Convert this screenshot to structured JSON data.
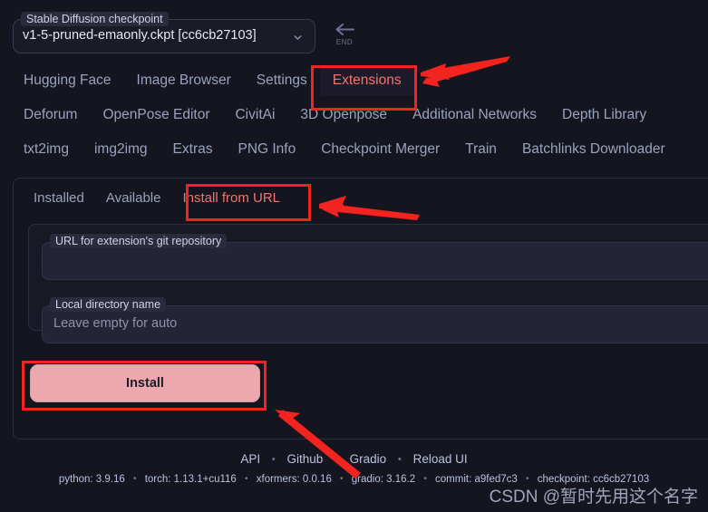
{
  "quick_settings": {
    "checkpoint": {
      "label": "Stable Diffusion checkpoint",
      "value": "v1-5-pruned-emaonly.ckpt [cc6cb27103]",
      "chevron_icon": "chevron-down-icon"
    },
    "end_key_hint": {
      "arrow_icon": "arrow-left-icon",
      "text": "END"
    }
  },
  "tabs": {
    "row1": [
      {
        "label": "Hugging Face",
        "selected": false
      },
      {
        "label": "Image Browser",
        "selected": false
      },
      {
        "label": "Settings",
        "selected": false
      },
      {
        "label": "Extensions",
        "selected": true
      }
    ],
    "row2": [
      {
        "label": "Deforum",
        "selected": false
      },
      {
        "label": "OpenPose Editor",
        "selected": false
      },
      {
        "label": "CivitAi",
        "selected": false
      },
      {
        "label": "3D Openpose",
        "selected": false
      },
      {
        "label": "Additional Networks",
        "selected": false
      },
      {
        "label": "Depth Library",
        "selected": false
      }
    ],
    "row3": [
      {
        "label": "txt2img",
        "selected": false
      },
      {
        "label": "img2img",
        "selected": false
      },
      {
        "label": "Extras",
        "selected": false
      },
      {
        "label": "PNG Info",
        "selected": false
      },
      {
        "label": "Checkpoint Merger",
        "selected": false
      },
      {
        "label": "Train",
        "selected": false
      },
      {
        "label": "Batchlinks Downloader",
        "selected": false
      }
    ]
  },
  "extensions": {
    "subtabs": [
      {
        "label": "Installed",
        "selected": false
      },
      {
        "label": "Available",
        "selected": false
      },
      {
        "label": "Install from URL",
        "selected": true
      }
    ],
    "fields": {
      "url": {
        "label": "URL for extension's git repository",
        "value": "",
        "placeholder": ""
      },
      "local_dir": {
        "label": "Local directory name",
        "value": "",
        "placeholder": "Leave empty for auto"
      }
    },
    "install_button": "Install"
  },
  "footer": {
    "links": [
      {
        "label": "API"
      },
      {
        "label": "Github"
      },
      {
        "label": "Gradio"
      },
      {
        "label": "Reload UI"
      }
    ],
    "separator": "•",
    "versions": [
      "python: 3.9.16",
      "torch: 1.13.1+cu116",
      "xformers: 0.0.16",
      "gradio: 3.16.2",
      "commit: a9fed7c3",
      "checkpoint: cc6cb27103"
    ]
  },
  "watermark": "CSDN @暂时先用这个名字",
  "annotations": {
    "color": "#f3241f",
    "boxes": [
      {
        "target": "extensions-tab"
      },
      {
        "target": "install-from-url-subtab"
      },
      {
        "target": "install-button"
      }
    ],
    "arrows": [
      {
        "target": "extensions-tab",
        "direction": "left"
      },
      {
        "target": "install-from-url-subtab",
        "direction": "left"
      },
      {
        "target": "install-button",
        "direction": "up-left"
      }
    ]
  },
  "colors": {
    "background": "#15151f",
    "panel": "#191926",
    "input": "#242436",
    "accent": "#f3746c",
    "install_button": "#eda8ae",
    "annotation": "#f3241f"
  }
}
